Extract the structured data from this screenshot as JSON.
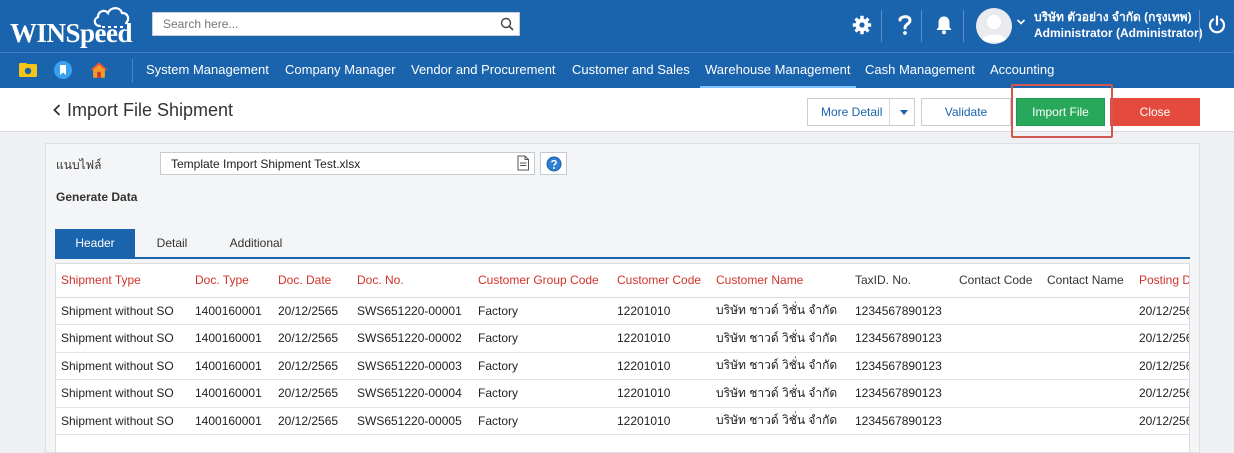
{
  "app": {
    "logo_text": "WINSpeed",
    "search_placeholder": "Search here...",
    "user": {
      "company": "บริษัท ตัวอย่าง จำกัด (กรุงเทพ)",
      "role": "Administrator (Administrator)"
    },
    "icons": [
      "settings-icon",
      "help-icon",
      "bell-icon",
      "power-icon"
    ],
    "colors": {
      "brand": "#1a63ad",
      "import": "#27a85a",
      "close": "#e44b3e",
      "required_header": "#d0332a"
    }
  },
  "nav": {
    "items": [
      {
        "label": "System Management"
      },
      {
        "label": "Company Manager"
      },
      {
        "label": "Vendor and Procurement"
      },
      {
        "label": "Customer and Sales"
      },
      {
        "label": "Warehouse Management"
      },
      {
        "label": "Cash Management"
      },
      {
        "label": "Accounting"
      }
    ],
    "active": "Warehouse Management"
  },
  "page": {
    "title": "Import File Shipment",
    "buttons": {
      "more_detail": "More Detail",
      "validate": "Validate",
      "import_file": "Import File",
      "close": "Close"
    }
  },
  "form": {
    "file_label": "แนบไฟล์",
    "file_value": "Template Import Shipment Test.xlsx",
    "section_title": "Generate Data"
  },
  "tabs": [
    {
      "label": "Header",
      "active": true
    },
    {
      "label": "Detail",
      "active": false
    },
    {
      "label": "Additional",
      "active": false
    }
  ],
  "table": {
    "columns": [
      {
        "label": "Shipment Type",
        "required": true
      },
      {
        "label": "Doc. Type",
        "required": true
      },
      {
        "label": "Doc. Date",
        "required": true
      },
      {
        "label": "Doc. No.",
        "required": true
      },
      {
        "label": "Customer Group Code",
        "required": true
      },
      {
        "label": "Customer Code",
        "required": true
      },
      {
        "label": "Customer Name",
        "required": true
      },
      {
        "label": "TaxID. No.",
        "required": false
      },
      {
        "label": "Contact Code",
        "required": false
      },
      {
        "label": "Contact Name",
        "required": false
      },
      {
        "label": "Posting D",
        "required": true
      }
    ],
    "rows": [
      [
        "Shipment without SO",
        "1400160001",
        "20/12/2565",
        "SWS651220-00001",
        "Factory",
        "12201010",
        "บริษัท ชาวด์ วิชั่น จำกัด",
        "1234567890123",
        "",
        "",
        "20/12/256"
      ],
      [
        "Shipment without SO",
        "1400160001",
        "20/12/2565",
        "SWS651220-00002",
        "Factory",
        "12201010",
        "บริษัท ชาวด์ วิชั่น จำกัด",
        "1234567890123",
        "",
        "",
        "20/12/256"
      ],
      [
        "Shipment without SO",
        "1400160001",
        "20/12/2565",
        "SWS651220-00003",
        "Factory",
        "12201010",
        "บริษัท ชาวด์ วิชั่น จำกัด",
        "1234567890123",
        "",
        "",
        "20/12/256"
      ],
      [
        "Shipment without SO",
        "1400160001",
        "20/12/2565",
        "SWS651220-00004",
        "Factory",
        "12201010",
        "บริษัท ชาวด์ วิชั่น จำกัด",
        "1234567890123",
        "",
        "",
        "20/12/256"
      ],
      [
        "Shipment without SO",
        "1400160001",
        "20/12/2565",
        "SWS651220-00005",
        "Factory",
        "12201010",
        "บริษัท ชาวด์ วิชั่น จำกัด",
        "1234567890123",
        "",
        "",
        "20/12/256"
      ]
    ]
  }
}
